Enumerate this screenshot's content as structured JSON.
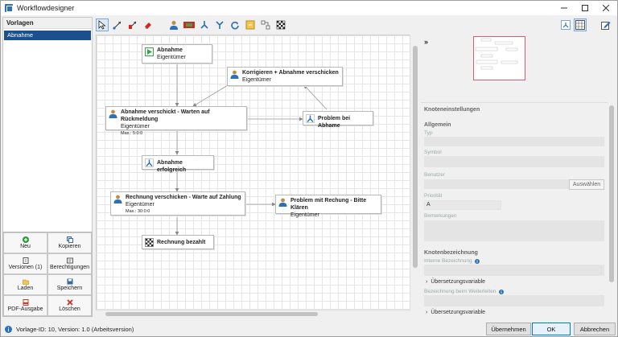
{
  "window": {
    "title": "Workflowdesigner"
  },
  "left": {
    "header": "Vorlagen",
    "templates": [
      "Abnahme"
    ],
    "buttons": [
      {
        "label": "Neu",
        "icon": "plus-circle-icon"
      },
      {
        "label": "Kopieren",
        "icon": "copy-icon"
      },
      {
        "label": "Versionen (1)",
        "icon": "versions-icon"
      },
      {
        "label": "Berechtigungen",
        "icon": "permissions-icon"
      },
      {
        "label": "Laden",
        "icon": "folder-icon"
      },
      {
        "label": "Speichern",
        "icon": "save-icon"
      },
      {
        "label": "PDF-Ausgabe",
        "icon": "pdf-icon"
      },
      {
        "label": "Löschen",
        "icon": "delete-icon"
      }
    ]
  },
  "nodes": {
    "n1": {
      "title": "Abnahme",
      "sub": "Eigentümer"
    },
    "n2": {
      "title": "Korrigieren + Abnahme verschicken",
      "sub": "Eigentümer"
    },
    "n3": {
      "title": "Abnahme verschickt - Warten auf Rückmeldung",
      "sub": "Eigentümer",
      "meta": "Max.: 5:0:0"
    },
    "n4": {
      "title": "Problem bei Abhame"
    },
    "n5": {
      "title": "Abnahme erfolgreich"
    },
    "n6": {
      "title": "Rechnung verschicken - Warte auf Zahlung",
      "sub": "Eigentümer",
      "meta": "Max.: 30:0:0"
    },
    "n7": {
      "title": "Problem mit Rechung - Bitte Klären",
      "sub": "Eigentümer"
    },
    "n8": {
      "title": "Rechnung bezahlt"
    }
  },
  "panel": {
    "expand": "»",
    "title": "Knoteneinstellungen",
    "general": "Allgemein",
    "type_label": "Typ",
    "symbol_label": "Symbol",
    "user_label": "Benutzer",
    "select_button": "Auswählen",
    "priority_label": "Priorität",
    "priority_value": "A",
    "remarks_label": "Bemerkungen",
    "naming": "Knotenbezeichnung",
    "internal_label": "Interne Bezeichnung",
    "translation1": "Übersetzungsvariable",
    "forward_label": "Bezeichnung beim Weiterleiten",
    "translation2": "Übersetzungsvariable"
  },
  "status": {
    "text": "Vorlage-ID: 10, Version: 1.0 (Arbeitsversion)"
  },
  "actions": {
    "apply": "Übernehmen",
    "ok": "OK",
    "cancel": "Abbrechen"
  },
  "colors": {
    "selection": "#1c4f8d",
    "minimap_border": "#e05a6b",
    "user_icon": "#2c70b8"
  }
}
